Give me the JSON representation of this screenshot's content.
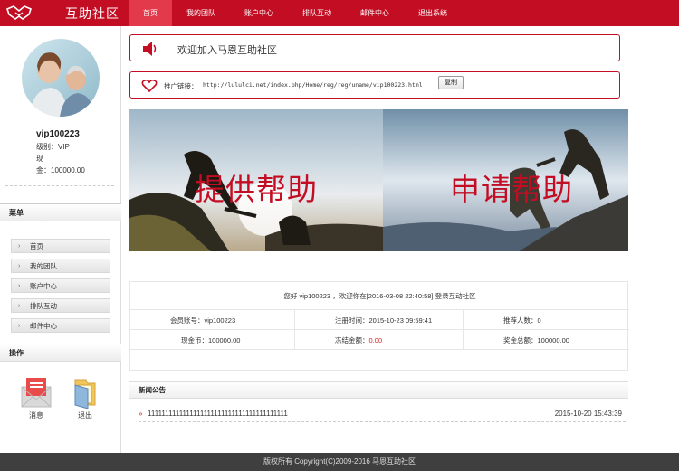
{
  "brand": {
    "title": "互助社区",
    "logo_icon": "handshake-icon"
  },
  "nav": {
    "items": [
      "首页",
      "我的团队",
      "账户中心",
      "排队互动",
      "邮件中心",
      "退出系统"
    ],
    "active_index": 0
  },
  "user": {
    "name": "vip100223",
    "level": "级别：VIP",
    "line2": "现",
    "balance": "金：100000.00"
  },
  "menu": {
    "title": "菜单",
    "items": [
      "首页",
      "我的团队",
      "账户中心",
      "排队互动",
      "邮件中心"
    ]
  },
  "ops": {
    "title": "操作",
    "items": [
      {
        "label": "消息",
        "icon": "mail-icon"
      },
      {
        "label": "退出",
        "icon": "folder-exit-icon"
      }
    ]
  },
  "notice": {
    "text": "欢迎加入马恩互助社区",
    "icon": "speaker-icon"
  },
  "promo": {
    "label": "推广链接：",
    "url": "http://lululci.net/index.php/Home/reg/reg/uname/vip100223.html",
    "copy_label": "复制",
    "icon": "heart-icon"
  },
  "banners": [
    {
      "text": "提供帮助"
    },
    {
      "text": "申请帮助"
    }
  ],
  "info": {
    "welcome": "您好 vip100223 ，欢迎你在[2016-03-08 22:40:58] 登录互动社区",
    "member_no_label": "会员账号：",
    "member_no": "vip100223",
    "reg_time_label": "注册时间：",
    "reg_time": "2015-10-23 09:59:41",
    "referrals_label": "推荐人数：",
    "referrals": "0",
    "cash_label": "现金币：",
    "cash": "100000.00",
    "frozen_label": "冻结金额：",
    "frozen": "0.00",
    "bonus_label": "奖金总额：",
    "bonus": "100000.00"
  },
  "news": {
    "title": "新闻公告",
    "items": [
      {
        "marker": "»",
        "text": "1111111111111111111111111111111111111111",
        "date": "2015-10-20 15:43:39"
      }
    ]
  },
  "footer": {
    "text": "版权所有 Copyright(C)2009-2016 马恩互助社区"
  },
  "colors": {
    "brand_red": "#c30d23",
    "active_nav": "#e23a4b",
    "footer_bg": "#3f3f3f"
  }
}
